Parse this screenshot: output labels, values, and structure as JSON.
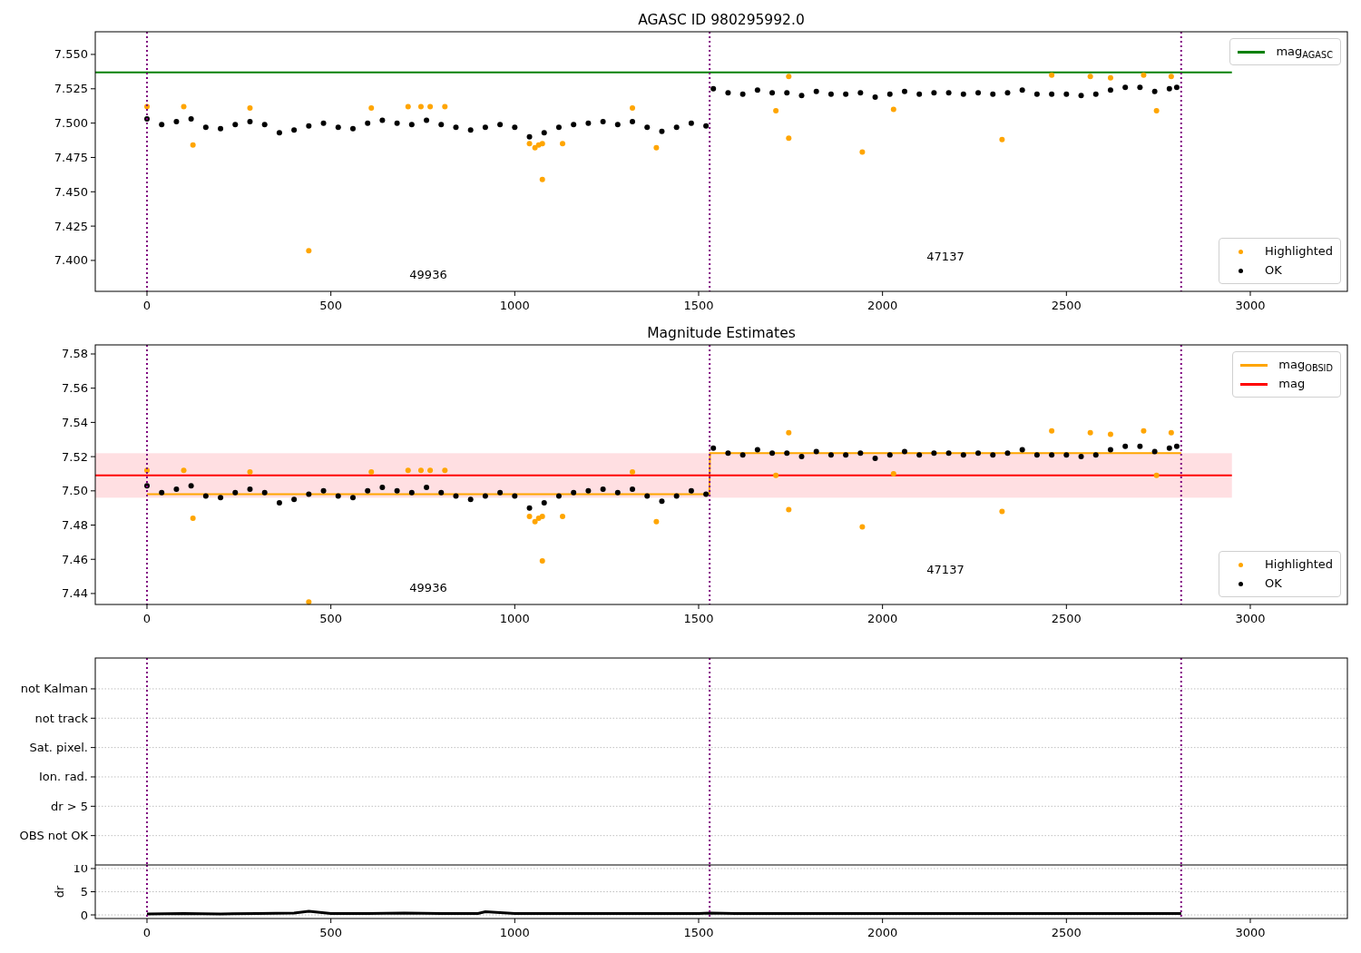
{
  "panels": [
    {
      "chart_data": {
        "type": "scatter",
        "title": "AGASC ID 980295992.0",
        "xlim": [
          -140.6,
          3264
        ],
        "ylim": [
          7.3775,
          7.5665
        ],
        "xticks": [
          0,
          500,
          1000,
          1500,
          2000,
          2500,
          3000
        ],
        "yticks": [
          {
            "value": 7.4,
            "label": "7.400"
          },
          {
            "value": 7.425,
            "label": "7.425"
          },
          {
            "value": 7.45,
            "label": "7.450"
          },
          {
            "value": 7.475,
            "label": "7.475"
          },
          {
            "value": 7.5,
            "label": "7.500"
          },
          {
            "value": 7.525,
            "label": "7.525"
          },
          {
            "value": 7.55,
            "label": "7.550"
          }
        ],
        "series": [
          {
            "name": "mag$_{AGASC}$",
            "type": "line",
            "color": "#008000",
            "x": [
              -140.6,
              2950
            ],
            "values": [
              7.537,
              7.537
            ]
          },
          {
            "name": "Highlighted",
            "type": "scatter",
            "color": "#ffa500",
            "x": [
              0,
              100,
              125,
              280,
              440,
              610,
              710,
              745,
              770,
              810,
              1040,
              1055,
              1065,
              1075,
              1075,
              1130,
              1320,
              1385,
              1710,
              1745,
              1745,
              1945,
              2030,
              2325,
              2460,
              2565,
              2620,
              2710,
              2745,
              2785
            ],
            "values": [
              7.512,
              7.512,
              7.484,
              7.511,
              7.407,
              7.511,
              7.512,
              7.512,
              7.512,
              7.512,
              7.485,
              7.482,
              7.484,
              7.485,
              7.459,
              7.485,
              7.511,
              7.482,
              7.509,
              7.534,
              7.489,
              7.479,
              7.51,
              7.488,
              7.535,
              7.534,
              7.533,
              7.535,
              7.509,
              7.534
            ]
          },
          {
            "name": "OK",
            "type": "scatter",
            "color": "#000000",
            "x": [
              0,
              40,
              80,
              120,
              160,
              200,
              240,
              280,
              320,
              360,
              400,
              440,
              480,
              520,
              560,
              600,
              640,
              680,
              720,
              760,
              800,
              840,
              880,
              920,
              960,
              1000,
              1040,
              1080,
              1120,
              1160,
              1200,
              1240,
              1280,
              1320,
              1360,
              1400,
              1440,
              1480,
              1520,
              1540,
              1580,
              1620,
              1660,
              1700,
              1740,
              1780,
              1820,
              1860,
              1900,
              1940,
              1980,
              2020,
              2060,
              2100,
              2140,
              2180,
              2220,
              2260,
              2300,
              2340,
              2380,
              2420,
              2460,
              2500,
              2540,
              2580,
              2620,
              2660,
              2700,
              2740,
              2780,
              2800
            ],
            "values": [
              7.503,
              7.499,
              7.501,
              7.503,
              7.497,
              7.496,
              7.499,
              7.501,
              7.499,
              7.493,
              7.495,
              7.498,
              7.5,
              7.497,
              7.496,
              7.5,
              7.502,
              7.5,
              7.499,
              7.502,
              7.499,
              7.497,
              7.495,
              7.497,
              7.499,
              7.497,
              7.49,
              7.493,
              7.497,
              7.499,
              7.5,
              7.501,
              7.499,
              7.501,
              7.497,
              7.494,
              7.497,
              7.5,
              7.498,
              7.525,
              7.522,
              7.521,
              7.524,
              7.522,
              7.522,
              7.52,
              7.523,
              7.521,
              7.521,
              7.522,
              7.519,
              7.521,
              7.523,
              7.521,
              7.522,
              7.522,
              7.521,
              7.522,
              7.521,
              7.522,
              7.524,
              7.521,
              7.521,
              7.521,
              7.52,
              7.521,
              7.524,
              7.526,
              7.526,
              7.523,
              7.525,
              7.526
            ]
          }
        ],
        "ref_lines": [
          {
            "axis": "x",
            "value": 0,
            "color": "#800080"
          },
          {
            "axis": "x",
            "value": 1530,
            "color": "#800080"
          },
          {
            "axis": "x",
            "value": 2812,
            "color": "#800080"
          }
        ],
        "annotations": [
          "49936",
          "47137"
        ]
      }
    },
    {
      "chart_data": {
        "type": "scatter",
        "title": "Magnitude Estimates",
        "xlim": [
          -140.6,
          3264
        ],
        "ylim": [
          7.4336,
          7.5853
        ],
        "xticks": [
          0,
          500,
          1000,
          1500,
          2000,
          2500,
          3000
        ],
        "yticks": [
          {
            "value": 7.44,
            "label": "7.44"
          },
          {
            "value": 7.46,
            "label": "7.46"
          },
          {
            "value": 7.48,
            "label": "7.48"
          },
          {
            "value": 7.5,
            "label": "7.50"
          },
          {
            "value": 7.52,
            "label": "7.52"
          },
          {
            "value": 7.54,
            "label": "7.54"
          },
          {
            "value": 7.56,
            "label": "7.56"
          },
          {
            "value": 7.58,
            "label": "7.58"
          }
        ],
        "bands": [
          {
            "axis": "y",
            "from": 7.496,
            "to": 7.522,
            "color": "#ffdfe2"
          }
        ],
        "series": [
          {
            "name": "mag$_{OBSID}$",
            "type": "line",
            "color": "#ffa500",
            "x": [
              0,
              1529,
              1531,
              2812
            ],
            "values": [
              7.498,
              7.498,
              7.522,
              7.522
            ]
          },
          {
            "name": "mag",
            "type": "line",
            "color": "#ff0000",
            "x": [
              -140.6,
              2950
            ],
            "values": [
              7.509,
              7.509
            ]
          },
          {
            "name": "Highlighted",
            "type": "scatter",
            "color": "#ffa500",
            "x": [
              0,
              100,
              125,
              280,
              440,
              610,
              710,
              745,
              770,
              810,
              1040,
              1055,
              1065,
              1075,
              1075,
              1130,
              1320,
              1385,
              1710,
              1745,
              1745,
              1945,
              2030,
              2325,
              2460,
              2565,
              2620,
              2710,
              2745,
              2785
            ],
            "values": [
              7.512,
              7.512,
              7.484,
              7.511,
              7.435,
              7.511,
              7.512,
              7.512,
              7.512,
              7.512,
              7.485,
              7.482,
              7.484,
              7.485,
              7.459,
              7.485,
              7.511,
              7.482,
              7.509,
              7.534,
              7.489,
              7.479,
              7.51,
              7.488,
              7.535,
              7.534,
              7.533,
              7.535,
              7.509,
              7.534
            ]
          },
          {
            "name": "OK",
            "type": "scatter",
            "color": "#000000",
            "x": [
              0,
              40,
              80,
              120,
              160,
              200,
              240,
              280,
              320,
              360,
              400,
              440,
              480,
              520,
              560,
              600,
              640,
              680,
              720,
              760,
              800,
              840,
              880,
              920,
              960,
              1000,
              1040,
              1080,
              1120,
              1160,
              1200,
              1240,
              1280,
              1320,
              1360,
              1400,
              1440,
              1480,
              1520,
              1540,
              1580,
              1620,
              1660,
              1700,
              1740,
              1780,
              1820,
              1860,
              1900,
              1940,
              1980,
              2020,
              2060,
              2100,
              2140,
              2180,
              2220,
              2260,
              2300,
              2340,
              2380,
              2420,
              2460,
              2500,
              2540,
              2580,
              2620,
              2660,
              2700,
              2740,
              2780,
              2800
            ],
            "values": [
              7.503,
              7.499,
              7.501,
              7.503,
              7.497,
              7.496,
              7.499,
              7.501,
              7.499,
              7.493,
              7.495,
              7.498,
              7.5,
              7.497,
              7.496,
              7.5,
              7.502,
              7.5,
              7.499,
              7.502,
              7.499,
              7.497,
              7.495,
              7.497,
              7.499,
              7.497,
              7.49,
              7.493,
              7.497,
              7.499,
              7.5,
              7.501,
              7.499,
              7.501,
              7.497,
              7.494,
              7.497,
              7.5,
              7.498,
              7.525,
              7.522,
              7.521,
              7.524,
              7.522,
              7.522,
              7.52,
              7.523,
              7.521,
              7.521,
              7.522,
              7.519,
              7.521,
              7.523,
              7.521,
              7.522,
              7.522,
              7.521,
              7.522,
              7.521,
              7.522,
              7.524,
              7.521,
              7.521,
              7.521,
              7.52,
              7.521,
              7.524,
              7.526,
              7.526,
              7.523,
              7.525,
              7.526
            ]
          }
        ],
        "ref_lines": [
          {
            "axis": "x",
            "value": 0,
            "color": "#800080"
          },
          {
            "axis": "x",
            "value": 1530,
            "color": "#800080"
          },
          {
            "axis": "x",
            "value": 2812,
            "color": "#800080"
          }
        ],
        "annotations": [
          "49936",
          "47137"
        ]
      }
    },
    {
      "flags": [
        "not Kalman",
        "not track",
        "Sat. pixel.",
        "Ion. rad.",
        "dr > 5",
        "OBS not OK"
      ]
    },
    {
      "chart_data": {
        "type": "line",
        "ylabel": "dr",
        "grid": true,
        "xlim": [
          -140.6,
          3264
        ],
        "ylim": [
          -0.78,
          10.78
        ],
        "xticks": [
          0,
          500,
          1000,
          1500,
          2000,
          2500,
          3000
        ],
        "yticks": [
          0,
          5,
          10
        ],
        "series": [
          {
            "type": "line",
            "color": "#000000",
            "x": [
              0,
              100,
              200,
              300,
              400,
              440,
              500,
              600,
              700,
              800,
              900,
              920,
              1000,
              1100,
              1200,
              1300,
              1400,
              1500,
              1530,
              1600,
              1700,
              1800,
              1900,
              2000,
              2100,
              2200,
              2300,
              2400,
              2500,
              2600,
              2700,
              2812
            ],
            "values": [
              0.2,
              0.3,
              0.2,
              0.3,
              0.4,
              0.8,
              0.3,
              0.3,
              0.4,
              0.3,
              0.3,
              0.7,
              0.3,
              0.3,
              0.3,
              0.3,
              0.3,
              0.3,
              0.4,
              0.3,
              0.3,
              0.3,
              0.3,
              0.3,
              0.3,
              0.3,
              0.3,
              0.3,
              0.3,
              0.3,
              0.3,
              0.3
            ]
          }
        ],
        "ref_lines": [
          {
            "axis": "x",
            "value": 0,
            "color": "#800080"
          },
          {
            "axis": "x",
            "value": 1530,
            "color": "#800080"
          },
          {
            "axis": "x",
            "value": 2812,
            "color": "#800080"
          }
        ]
      }
    }
  ]
}
